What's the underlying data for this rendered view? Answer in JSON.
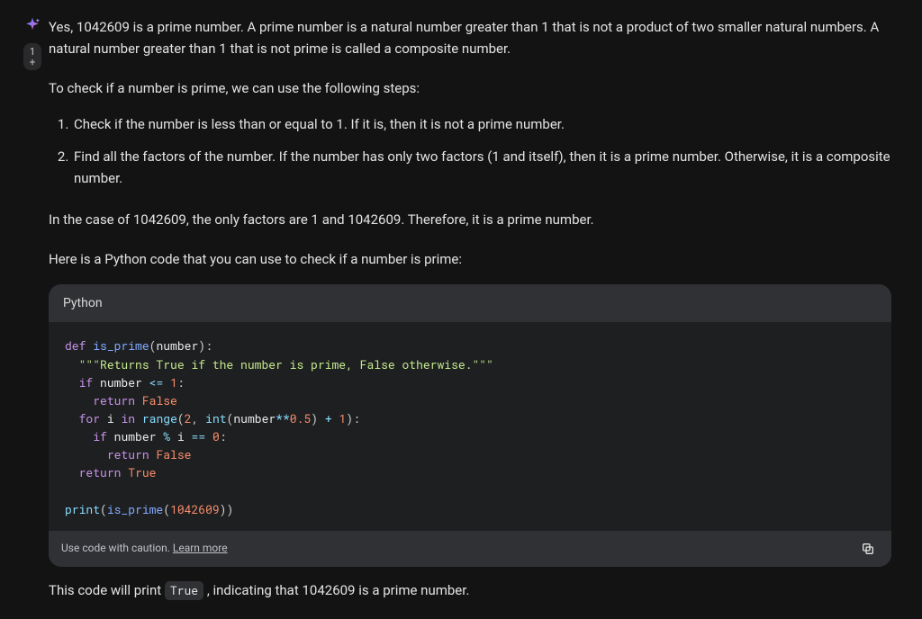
{
  "gutter": {
    "drafts_count": "1",
    "drafts_more": "+"
  },
  "response": {
    "intro": "Yes, 1042609 is a prime number. A prime number is a natural number greater than 1 that is not a product of two smaller natural numbers. A natural number greater than 1 that is not prime is called a composite number.",
    "steps_intro": "To check if a number is prime, we can use the following steps:",
    "steps": [
      "Check if the number is less than or equal to 1. If it is, then it is not a prime number.",
      "Find all the factors of the number. If the number has only two factors (1 and itself), then it is a prime number. Otherwise, it is a composite number."
    ],
    "case": "In the case of 1042609, the only factors are 1 and 1042609. Therefore, it is a prime number.",
    "code_intro": "Here is a Python code that you can use to check if a number is prime:",
    "outro_before": "This code will print ",
    "outro_code": "True",
    "outro_after": " , indicating that 1042609 is a prime number."
  },
  "code_block": {
    "language": "Python",
    "caution_prefix": "Use code with caution. ",
    "learn_more": "Learn more",
    "lines": {
      "def": "def",
      "is_prime": "is_prime",
      "number": "number",
      "doc": "\"\"\"Returns True if the number is prime, False otherwise.\"\"\"",
      "if": "if",
      "leq": "<=",
      "one": "1",
      "colon": ":",
      "return": "return",
      "false": "False",
      "for": "for",
      "i": "i",
      "in": "in",
      "range": "range",
      "two": "2",
      "int": "int",
      "star": "**",
      "half": "0.5",
      "plus": "+",
      "mod": "%",
      "eq": "==",
      "zero": "0",
      "true": "True",
      "print": "print",
      "bignum": "1042609"
    }
  }
}
